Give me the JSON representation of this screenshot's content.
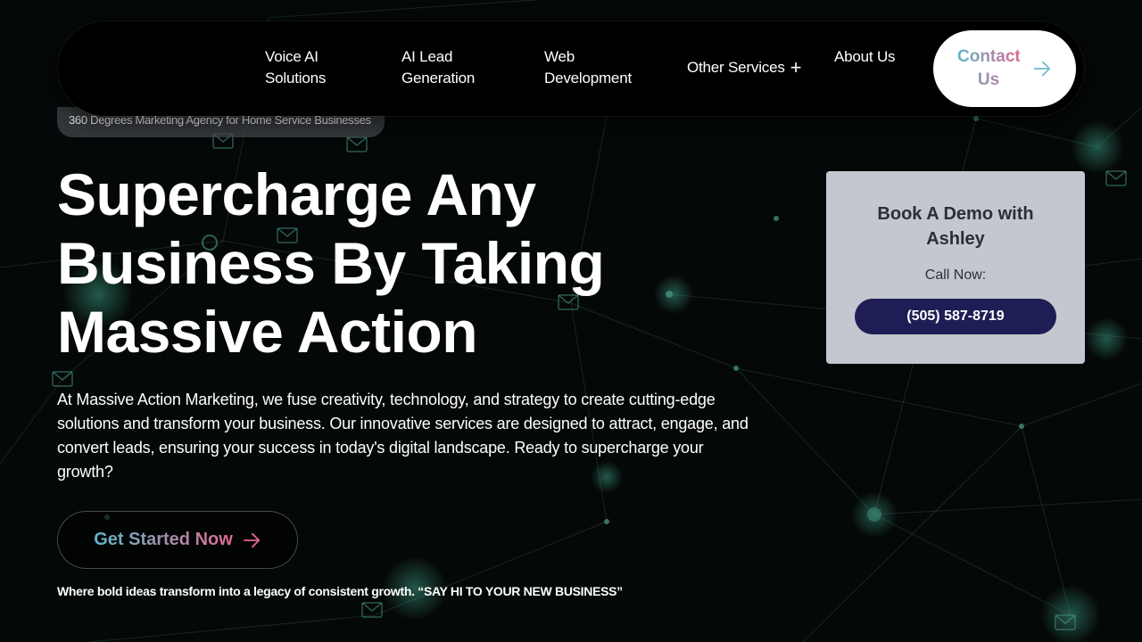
{
  "nav": {
    "items": [
      {
        "label": "Voice AI Solutions"
      },
      {
        "label": "AI Lead Generation"
      },
      {
        "label": "Web Development"
      },
      {
        "label": "Other Services"
      },
      {
        "label": "About Us"
      }
    ],
    "contact_label": "Contact Us"
  },
  "hero": {
    "tagline": "360 Degrees Marketing Agency for Home Service Businesses",
    "title": "Supercharge Any Business By Taking Massive Action",
    "description": "At Massive Action Marketing, we fuse creativity, technology, and strategy to create cutting-edge solutions and transform your business. Our innovative services are designed to attract, engage, and convert leads, ensuring your success in today's digital landscape. Ready to supercharge your growth?",
    "cta_label": "Get Started Now",
    "footer_line": "Where bold ideas transform into a legacy of consistent growth. “SAY HI TO YOUR NEW BUSINESS”"
  },
  "demo_card": {
    "title": "Book A Demo with Ashley",
    "call_label": "Call Now:",
    "phone": "(505) 587-8719"
  },
  "colors": {
    "background": "#050808",
    "network_accent": "#2f7a66",
    "gradient_start": "#5fb7c8",
    "gradient_end": "#d86a94",
    "phone_button": "#1e1d55",
    "card_background": "#c4c7cf"
  },
  "icons": {
    "nav_expand": "plus-icon",
    "contact_arrow": "arrow-right-icon",
    "cta_arrow": "arrow-right-icon"
  }
}
